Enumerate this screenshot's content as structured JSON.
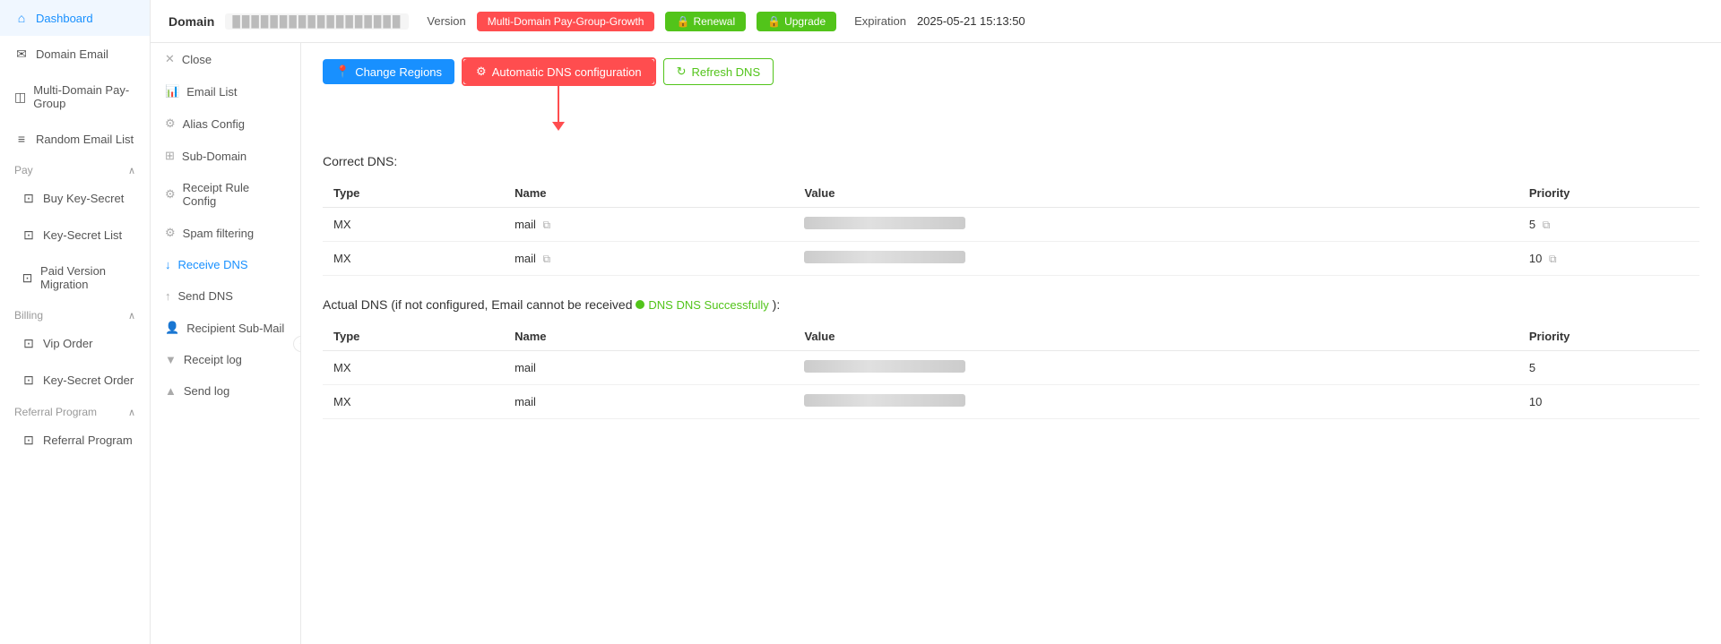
{
  "sidebar": {
    "items": [
      {
        "id": "dashboard",
        "label": "Dashboard",
        "icon": "⌂"
      },
      {
        "id": "domain-email",
        "label": "Domain Email",
        "icon": "✉"
      },
      {
        "id": "multi-domain",
        "label": "Multi-Domain Pay-Group",
        "icon": "◫"
      },
      {
        "id": "random-email",
        "label": "Random Email List",
        "icon": "≡"
      },
      {
        "id": "pay-group",
        "label": "Pay",
        "icon": "",
        "expandable": true,
        "expanded": true
      },
      {
        "id": "buy-key-secret",
        "label": "Buy Key-Secret",
        "icon": "⊡",
        "sub": true
      },
      {
        "id": "key-secret-list",
        "label": "Key-Secret List",
        "icon": "⊡",
        "sub": true
      },
      {
        "id": "paid-version",
        "label": "Paid Version Migration",
        "icon": "⊡",
        "sub": true
      },
      {
        "id": "billing-group",
        "label": "Billing",
        "icon": "",
        "expandable": true,
        "expanded": true
      },
      {
        "id": "vip-order",
        "label": "Vip Order",
        "icon": "⊡",
        "sub": true
      },
      {
        "id": "key-secret-order",
        "label": "Key-Secret Order",
        "icon": "⊡",
        "sub": true
      },
      {
        "id": "referral-group",
        "label": "Referral Program",
        "icon": "",
        "expandable": true,
        "expanded": true
      },
      {
        "id": "referral-program",
        "label": "Referral Program",
        "icon": "⊡",
        "sub": true
      }
    ]
  },
  "header": {
    "domain_label": "Domain",
    "domain_value": "██████████████████",
    "version_label": "Version",
    "version_value": "Multi-Domain Pay-Group-Growth",
    "renewal_label": "Renewal",
    "upgrade_label": "Upgrade",
    "expiration_label": "Expiration",
    "expiration_value": "2025-05-21 15:13:50"
  },
  "sub_sidebar": {
    "items": [
      {
        "id": "close",
        "label": "Close",
        "icon": "✕"
      },
      {
        "id": "email-list",
        "label": "Email List",
        "icon": "📊"
      },
      {
        "id": "alias-config",
        "label": "Alias Config",
        "icon": "⚙"
      },
      {
        "id": "sub-domain",
        "label": "Sub-Domain",
        "icon": "⊞"
      },
      {
        "id": "receipt-rule",
        "label": "Receipt Rule Config",
        "icon": "⚙"
      },
      {
        "id": "spam-filtering",
        "label": "Spam filtering",
        "icon": "⚙"
      },
      {
        "id": "receive-dns",
        "label": "Receive DNS",
        "icon": "↓",
        "active": true
      },
      {
        "id": "send-dns",
        "label": "Send DNS",
        "icon": "↑"
      },
      {
        "id": "recipient-sub-mail",
        "label": "Recipient Sub-Mail",
        "icon": "👤"
      },
      {
        "id": "receipt-log",
        "label": "Receipt log",
        "icon": "▼"
      },
      {
        "id": "send-log",
        "label": "Send log",
        "icon": "▲"
      }
    ]
  },
  "main": {
    "buttons": {
      "change_regions": "Change Regions",
      "auto_dns": "Automatic DNS configuration",
      "refresh_dns": "Refresh DNS"
    },
    "correct_dns": {
      "title": "Correct DNS:",
      "columns": [
        "Type",
        "Name",
        "Value",
        "Priority"
      ],
      "rows": [
        {
          "type": "MX",
          "name": "mail",
          "value": "████████████████████████",
          "priority": "5"
        },
        {
          "type": "MX",
          "name": "mail",
          "value": "████████████████████████",
          "priority": "10"
        }
      ]
    },
    "actual_dns": {
      "title": "Actual DNS (if not configured, Email cannot be received",
      "status_text": "DNS DNS Successfully",
      "title_suffix": "):",
      "columns": [
        "Type",
        "Name",
        "Value",
        "Priority"
      ],
      "rows": [
        {
          "type": "MX",
          "name": "mail",
          "value": "████████████████████████",
          "priority": "5"
        },
        {
          "type": "MX",
          "name": "mail",
          "value": "████████████████████████",
          "priority": "10"
        }
      ]
    }
  }
}
